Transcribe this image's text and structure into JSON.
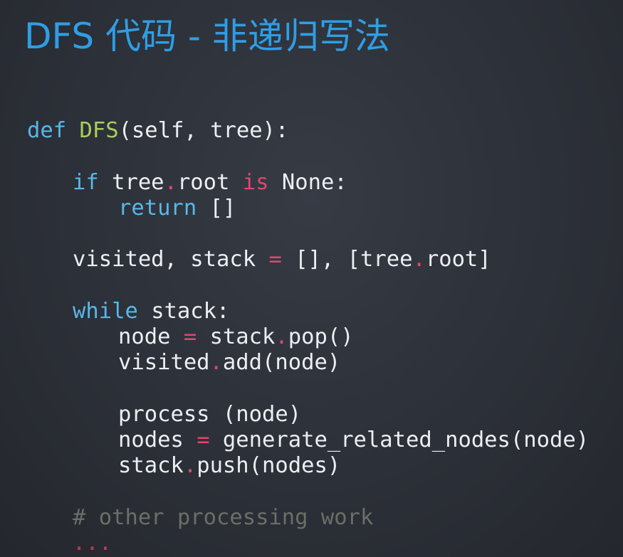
{
  "slide": {
    "title": "DFS 代码 - 非递归写法"
  },
  "code": {
    "language": "python",
    "colors": {
      "background": "#2c3038",
      "title": "#2e9ee6",
      "keyword": "#59b7e8",
      "function_name": "#a9cf5a",
      "operator": "#e2466e",
      "comment": "#6b6f66",
      "text": "#eceff2"
    },
    "lines": [
      {
        "tokens": [
          {
            "type": "kw",
            "text": "def"
          },
          {
            "type": "tx",
            "text": " "
          },
          {
            "type": "fn",
            "text": "DFS"
          },
          {
            "type": "tx",
            "text": "(self, tree):"
          }
        ]
      },
      {
        "tokens": [
          {
            "type": "kw",
            "text": "if"
          },
          {
            "type": "tx",
            "text": " tree"
          },
          {
            "type": "op",
            "text": "."
          },
          {
            "type": "tx",
            "text": "root "
          },
          {
            "type": "op",
            "text": "is"
          },
          {
            "type": "tx",
            "text": " None:"
          }
        ]
      },
      {
        "tokens": [
          {
            "type": "kw",
            "text": "return"
          },
          {
            "type": "tx",
            "text": " []"
          }
        ]
      },
      {
        "tokens": [
          {
            "type": "tx",
            "text": "visited, stack "
          },
          {
            "type": "op",
            "text": "="
          },
          {
            "type": "tx",
            "text": " [], [tree"
          },
          {
            "type": "op",
            "text": "."
          },
          {
            "type": "tx",
            "text": "root]"
          }
        ]
      },
      {
        "tokens": [
          {
            "type": "kw",
            "text": "while"
          },
          {
            "type": "tx",
            "text": " stack:"
          }
        ]
      },
      {
        "tokens": [
          {
            "type": "tx",
            "text": "node "
          },
          {
            "type": "op",
            "text": "="
          },
          {
            "type": "tx",
            "text": " stack"
          },
          {
            "type": "op",
            "text": "."
          },
          {
            "type": "tx",
            "text": "pop()"
          }
        ]
      },
      {
        "tokens": [
          {
            "type": "tx",
            "text": "visited"
          },
          {
            "type": "op",
            "text": "."
          },
          {
            "type": "tx",
            "text": "add(node)"
          }
        ]
      },
      {
        "tokens": [
          {
            "type": "tx",
            "text": "process (node)"
          }
        ]
      },
      {
        "tokens": [
          {
            "type": "tx",
            "text": "nodes "
          },
          {
            "type": "op",
            "text": "="
          },
          {
            "type": "tx",
            "text": " generate_related_nodes(node)"
          }
        ]
      },
      {
        "tokens": [
          {
            "type": "tx",
            "text": "stack"
          },
          {
            "type": "op",
            "text": "."
          },
          {
            "type": "tx",
            "text": "push(nodes)"
          }
        ]
      },
      {
        "tokens": [
          {
            "type": "cmt",
            "text": "# other processing work"
          }
        ]
      },
      {
        "tokens": [
          {
            "type": "dots",
            "text": "..."
          }
        ]
      }
    ]
  }
}
